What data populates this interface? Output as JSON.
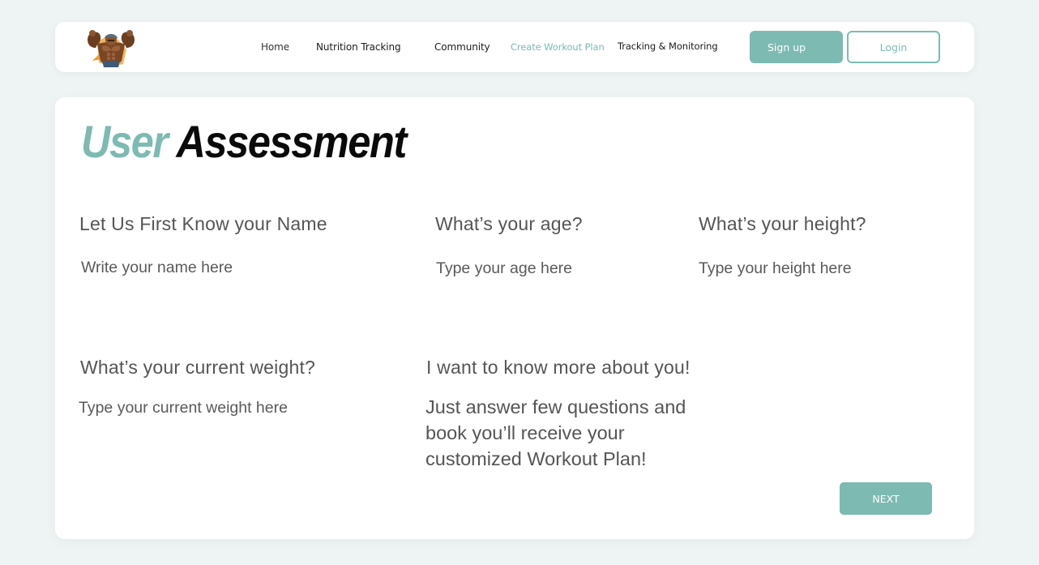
{
  "nav": {
    "logo_icon": "bodybuilder-mascot-icon",
    "links": [
      "Home",
      "Nutrition Tracking",
      "Community",
      "Create Workout Plan",
      "Tracking & Monitoring"
    ],
    "active_link": "Create Workout Plan",
    "signup_label": "Sign up",
    "login_label": "Login"
  },
  "title": {
    "accent": "User",
    "main": "Assessment"
  },
  "fields": {
    "name": {
      "label": "Let Us First Know your Name",
      "placeholder": "Write your name here"
    },
    "age": {
      "label": "What’s your age?",
      "placeholder": "Type your age here"
    },
    "height": {
      "label": "What’s your height?",
      "placeholder": "Type your height here"
    },
    "weight": {
      "label": "What’s your current weight?",
      "placeholder": "Type your current weight here"
    }
  },
  "about": {
    "heading": "I want to know more about you!",
    "text": "Just answer few questions and book you’ll receive your customized Workout Plan!"
  },
  "next_label": "NEXT",
  "colors": {
    "accent": "#7dbab2",
    "background": "#eef4f4",
    "text": "#555555"
  }
}
